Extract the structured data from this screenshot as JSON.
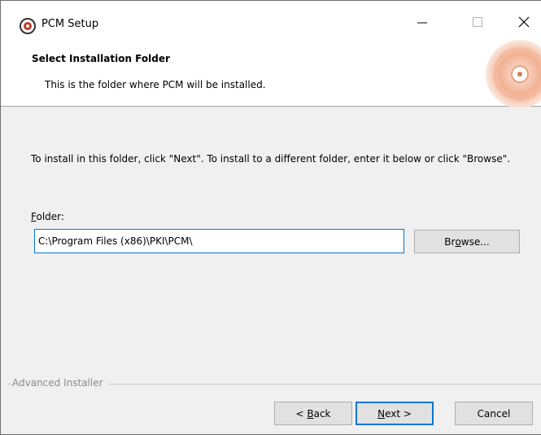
{
  "window": {
    "title": "PCM Setup",
    "app_icon": "pcm-setup-icon",
    "controls": {
      "minimize_icon": "minimize-icon",
      "maximize_icon": "maximize-icon",
      "close_icon": "close-icon"
    }
  },
  "header": {
    "title": "Select Installation Folder",
    "subtitle": "This is the folder where PCM will be installed."
  },
  "body": {
    "instructions": "To install in this folder, click \"Next\". To install to a different folder, enter it below or click \"Browse\".",
    "folder_label_first": "F",
    "folder_label_rest": "older:",
    "folder_value": "C:\\Program Files (x86)\\PKI\\PCM\\",
    "browse_pre": "Br",
    "browse_u": "o",
    "browse_post": "wse..."
  },
  "footer": {
    "branding": "Advanced Installer",
    "back_pre": "< ",
    "back_u": "B",
    "back_post": "ack",
    "next_u": "N",
    "next_post": "ext >",
    "cancel": "Cancel"
  }
}
